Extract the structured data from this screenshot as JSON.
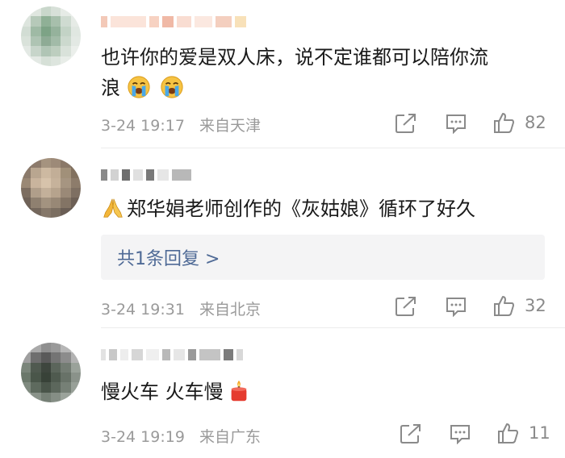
{
  "comments": [
    {
      "text_line1": "也许你的爱是双人床，说不定谁都可以陪你流",
      "text_line2": "浪",
      "emoji_names": [
        "crying-face-icon",
        "crying-face-icon"
      ],
      "date": "3-24 19:17",
      "location": "来自天津",
      "likes": "82"
    },
    {
      "text": "郑华娟老师创作的《灰姑娘》循环了好久",
      "prefix_emoji": "folded-hands-icon",
      "reply_label": "共1条回复 >",
      "date": "3-24 19:31",
      "location": "来自北京",
      "likes": "32"
    },
    {
      "text": "慢火车 火车慢",
      "suffix_emoji": "candle-icon",
      "date": "3-24 19:19",
      "location": "来自广东",
      "likes": "11"
    }
  ],
  "icons": {
    "share": "share-icon",
    "comment": "comment-icon",
    "like": "thumbs-up-icon"
  }
}
